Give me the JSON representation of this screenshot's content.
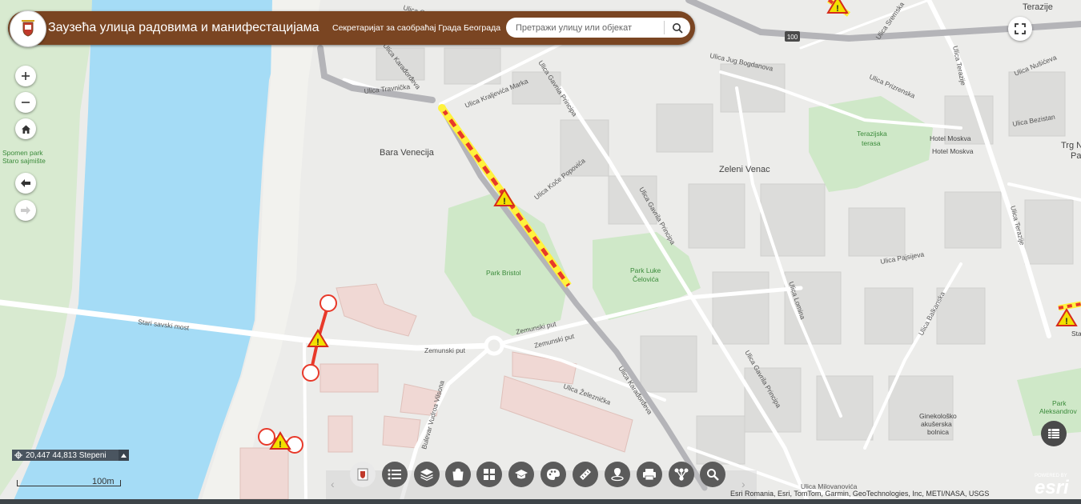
{
  "header": {
    "title": "Заузећа улица радовима и манифестацијама",
    "subtitle": "Секретаријат за саобраћај Града Београда"
  },
  "search": {
    "placeholder": "Претражи улицу или објекат"
  },
  "coords": {
    "text": "20,447 44,813 Stepeni"
  },
  "scale": {
    "label": "100m"
  },
  "attribution": "Esri Romania, Esri, TomTom, Garmin, GeoTechnologies, Inc, METI/NASA, USGS",
  "esri": {
    "powered": "POWERED BY",
    "name": "esri"
  },
  "road_badge": "100",
  "colors": {
    "header": "#7a4522",
    "river": "#a5dcf6",
    "park": "#cfe8c8",
    "closure_red": "#e8392a",
    "closure_yellow": "#fff23d"
  },
  "map_labels": {
    "bara_venecija": "Bara Venecija",
    "zeleni_venac": "Zeleni Venac",
    "terazije": "Terazije",
    "trg_n": "Trg N",
    "trg_pa": "Pa",
    "park_bristol": "Park Bristol",
    "park_luke": "Park Luke",
    "celovica": "Čelovića",
    "terazijska": "Terazijska",
    "terasa": "terasa",
    "hotel_moskva_1": "Hotel Moskva",
    "hotel_moskva_2": "Hotel Moskva",
    "spomen_park": "Spomen park",
    "staro_sajmiste": "Staro sajmište",
    "park_aleksandrov": "Park",
    "aleksandrov": "Aleksandrov",
    "ginekolosko": "Ginekološko",
    "akuserska": "akušerska",
    "bolnica": "bolnica",
    "sta": "Sta",
    "stari_savski_most": "Stari savski most",
    "zemunski_put_1": "Zemunski put",
    "zemunski_put_2": "Zemunski put",
    "zemunski_put_3": "Zemunski put",
    "ulica_karadjordjeva_1": "Ulica Karađorđeva",
    "ulica_karadjordjeva_2": "Ulica Karađorđeva",
    "ulica_travnicka": "Ulica Travnička",
    "ulica_kraljevica_marka": "Ulica Kraljevića Marka",
    "ulica_gavrila_principa_1": "Ulica Gavrila Principa",
    "ulica_gavrila_principa_2": "Ulica Gavrila Principa",
    "ulica_gavrila_principa_3": "Ulica Gavrila Principa",
    "ulica_koce_popovica": "Ulica Koče Popovića",
    "ulica_jug_bogdanova": "Ulica Jug Bogdanova",
    "ulica_prizrenska": "Ulica Prizrenska",
    "ulica_nusiceva": "Ulica Nušićeva",
    "ulica_bezistan": "Ulica Bezistan",
    "ulica_terazije_1": "Ulica Terazije",
    "ulica_terazije_2": "Ulica Terazije",
    "ulica_pajsijeva": "Ulica Pajsijeva",
    "ulica_lomina": "Ulica Lomina",
    "ulica_balkanska": "Ulica Balkanska",
    "ulica_zeleznicka": "Ulica Železnička",
    "bulevar_vojvode_misica": "Bulevar Vudroa Vilsona",
    "ulica_sremska": "Ulica Sremska",
    "ulica_crno": "Ulica Crno",
    "ulica_kosancicev": "Ulica Milovanovića"
  }
}
